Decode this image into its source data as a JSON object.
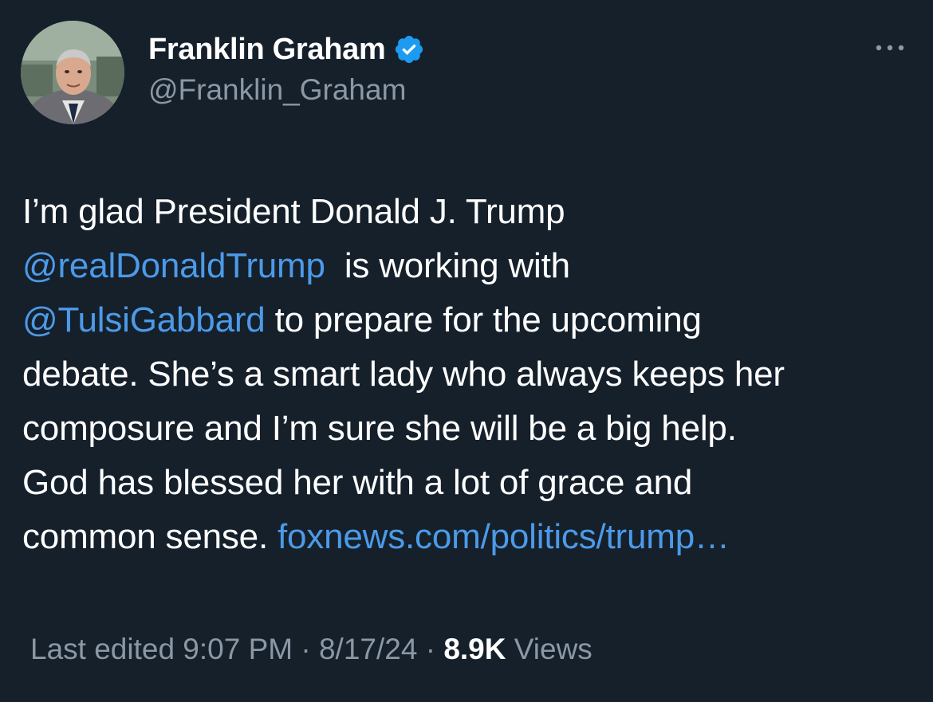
{
  "author": {
    "display_name": "Franklin Graham",
    "handle": "@Franklin_Graham",
    "verified_icon": "verified-badge-icon"
  },
  "tweet": {
    "line1": "I’m glad President Donald J. Trump",
    "mention1": "@realDonaldTrump",
    "line2_rest": "  is working with",
    "mention2": "@TulsiGabbard",
    "line3_rest": " to prepare for the upcoming",
    "line4": "debate. She’s a smart lady who always keeps her",
    "line5": "composure and I’m sure she will be a big help.",
    "line6": "God has blessed her with a lot of grace and",
    "line7_start": "common sense. ",
    "link": "foxnews.com/politics/trump…"
  },
  "meta": {
    "edited_label": "Last edited 9:07 PM · 8/17/24",
    "separator": " · ",
    "views_count": "8.9K",
    "views_label": " Views"
  },
  "colors": {
    "background": "#15202b",
    "link": "#4c9ae8",
    "secondary_text": "#8b98a5",
    "verified": "#1d9bf0"
  }
}
